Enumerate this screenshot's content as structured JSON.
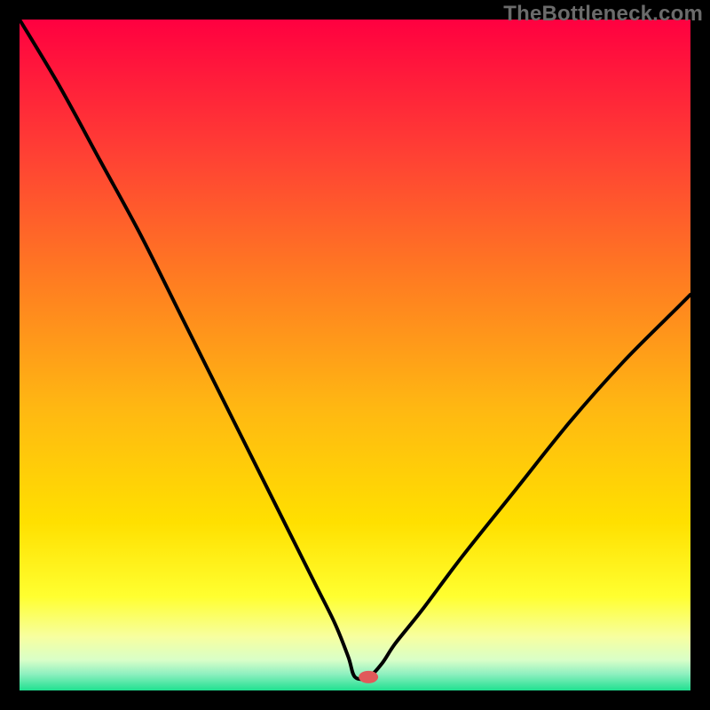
{
  "watermark": "TheBottleneck.com",
  "chart_data": {
    "type": "line",
    "title": "",
    "xlabel": "",
    "ylabel": "",
    "xlim": [
      0,
      100
    ],
    "ylim": [
      0,
      100
    ],
    "grid": false,
    "legend": false,
    "annotations": [
      {
        "type": "marker",
        "x": 52,
        "y": 2,
        "color": "#e05a5a"
      }
    ],
    "background_gradient_stops": [
      {
        "pos": 0.0,
        "color": "#ff0040"
      },
      {
        "pos": 0.2,
        "color": "#ff4034"
      },
      {
        "pos": 0.4,
        "color": "#ff8020"
      },
      {
        "pos": 0.58,
        "color": "#ffb812"
      },
      {
        "pos": 0.75,
        "color": "#ffe000"
      },
      {
        "pos": 0.86,
        "color": "#ffff30"
      },
      {
        "pos": 0.92,
        "color": "#f7ffa0"
      },
      {
        "pos": 0.955,
        "color": "#d8ffc8"
      },
      {
        "pos": 0.975,
        "color": "#90f0c0"
      },
      {
        "pos": 1.0,
        "color": "#20e090"
      }
    ],
    "series": [
      {
        "name": "bottleneck-curve",
        "x": [
          0,
          6,
          12,
          18,
          24,
          28,
          32,
          36,
          40,
          44,
          47,
          49,
          50,
          52,
          54,
          56,
          60,
          66,
          74,
          82,
          90,
          98,
          100
        ],
        "values": [
          100,
          90,
          79,
          68,
          56,
          48,
          40,
          32,
          24,
          16,
          10,
          5,
          2,
          2,
          4,
          7,
          12,
          20,
          30,
          40,
          49,
          57,
          59
        ]
      }
    ]
  }
}
